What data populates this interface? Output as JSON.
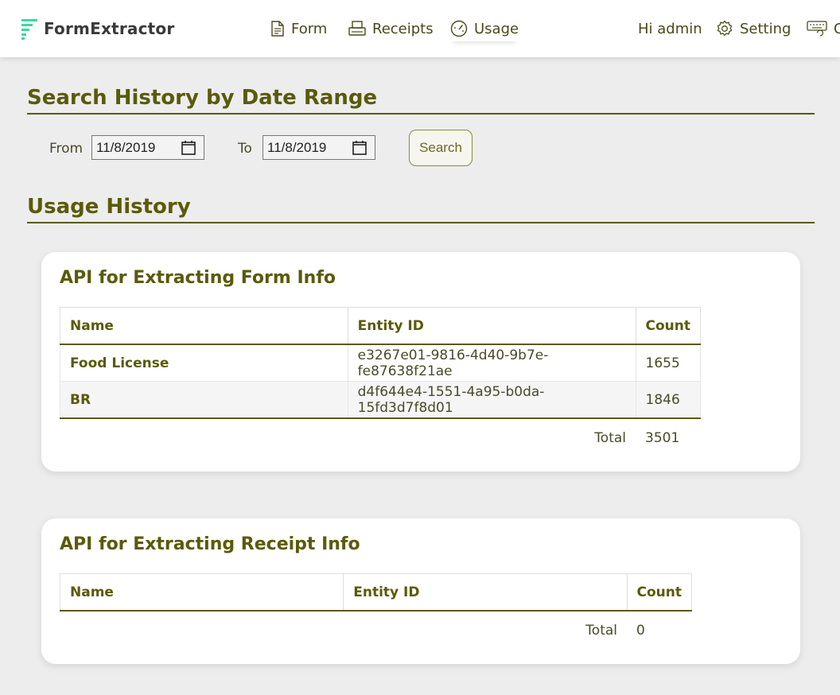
{
  "app": {
    "name": "FormExtractor"
  },
  "nav": {
    "form": "Form",
    "receipts": "Receipts",
    "usage": "Usage",
    "greeting": "Hi admin",
    "setting": "Setting",
    "extra": "C"
  },
  "search": {
    "title": "Search History by Date Range",
    "from_label": "From",
    "from_value": "11/8/2019",
    "to_label": "To",
    "to_value": "11/8/2019",
    "button": "Search"
  },
  "usage": {
    "title": "Usage History"
  },
  "form_api": {
    "title": "API for Extracting Form Info",
    "columns": [
      "Name",
      "Entity ID",
      "Count"
    ],
    "rows": [
      {
        "name": "Food License",
        "entity_id": "e3267e01-9816-4d40-9b7e-fe87638f21ae",
        "count": "1655"
      },
      {
        "name": "BR",
        "entity_id": "d4f644e4-1551-4a95-b0da-15fd3d7f8d01",
        "count": "1846"
      }
    ],
    "total_label": "Total",
    "total_value": "3501"
  },
  "receipt_api": {
    "title": "API for Extracting Receipt Info",
    "columns": [
      "Name",
      "Entity ID",
      "Count"
    ],
    "rows": [],
    "total_label": "Total",
    "total_value": "0"
  },
  "colors": {
    "accent": "#5a5a0a",
    "logo": "#3dd6a0",
    "background": "#ededed"
  }
}
